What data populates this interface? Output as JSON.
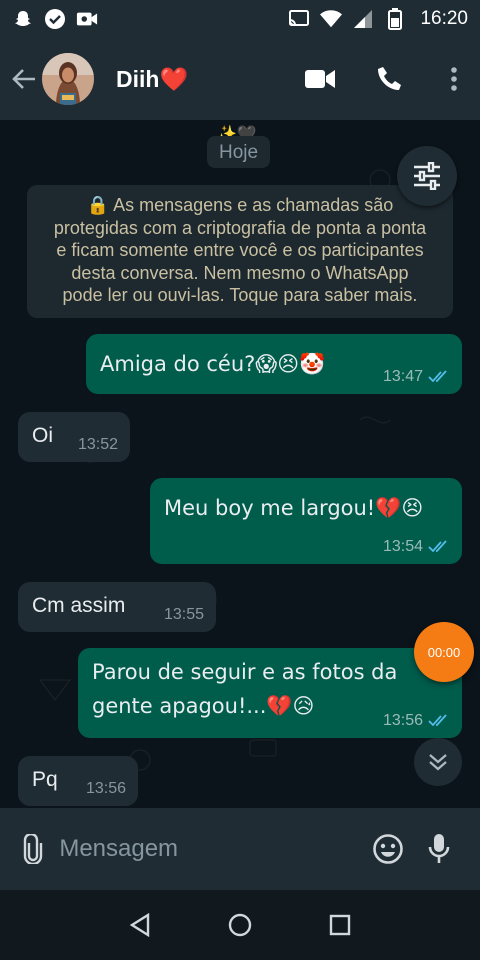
{
  "status_bar": {
    "time": "16:20",
    "icons": [
      "snapchat-icon",
      "check-circle-icon",
      "video-camera-icon",
      "cast-icon",
      "wifi-icon",
      "signal-icon",
      "battery-icon"
    ]
  },
  "header": {
    "contact_name": "Diih❤️",
    "icons": [
      "back-arrow-icon",
      "video-call-icon",
      "phone-icon",
      "more-vertical-icon"
    ]
  },
  "chat": {
    "date_sparkles": "✨🖤",
    "date_label": "Hoje",
    "encryption_notice": "🔒 As mensagens e as chamadas são protegidas com a criptografia de ponta a ponta e ficam somente entre você e os participantes desta conversa. Nem mesmo o WhatsApp pode ler ou ouvi-las. Toque para saber mais.",
    "encryption_lines": [
      "🔒 As mensagens e as chamadas são",
      "protegidas com a criptografia de ponta a ponta",
      "e ficam somente entre você e os participantes",
      "desta conversa. Nem mesmo o WhatsApp",
      "pode ler ou ouvi-las. Toque para saber mais."
    ],
    "messages": [
      {
        "direction": "out",
        "lines": [
          "Amiga do céu?😱😣🤡"
        ],
        "time": "13:47",
        "read": true
      },
      {
        "direction": "in",
        "lines": [
          "Oi"
        ],
        "time": "13:52"
      },
      {
        "direction": "out",
        "lines": [
          "Meu boy me largou!💔😣"
        ],
        "time": "13:54",
        "read": true
      },
      {
        "direction": "in",
        "lines": [
          "Cm assim"
        ],
        "time": "13:55"
      },
      {
        "direction": "out",
        "lines": [
          "Parou de seguir e as fotos da",
          "gente apagou!...💔😥"
        ],
        "time": "13:56",
        "read": true
      },
      {
        "direction": "in",
        "lines": [
          "Pq"
        ],
        "time": "13:56"
      }
    ],
    "recording_timer": "00:00"
  },
  "composer": {
    "placeholder": "Mensagem",
    "icons": [
      "attach-icon",
      "emoji-icon",
      "microphone-icon"
    ]
  },
  "colors": {
    "header_bg": "#1f2c33",
    "chat_bg": "#0b141a",
    "outgoing_bubble": "#005c4b",
    "incoming_bubble": "#1f2c33",
    "read_ticks": "#53bdeb",
    "recording_badge": "#f57c14"
  }
}
